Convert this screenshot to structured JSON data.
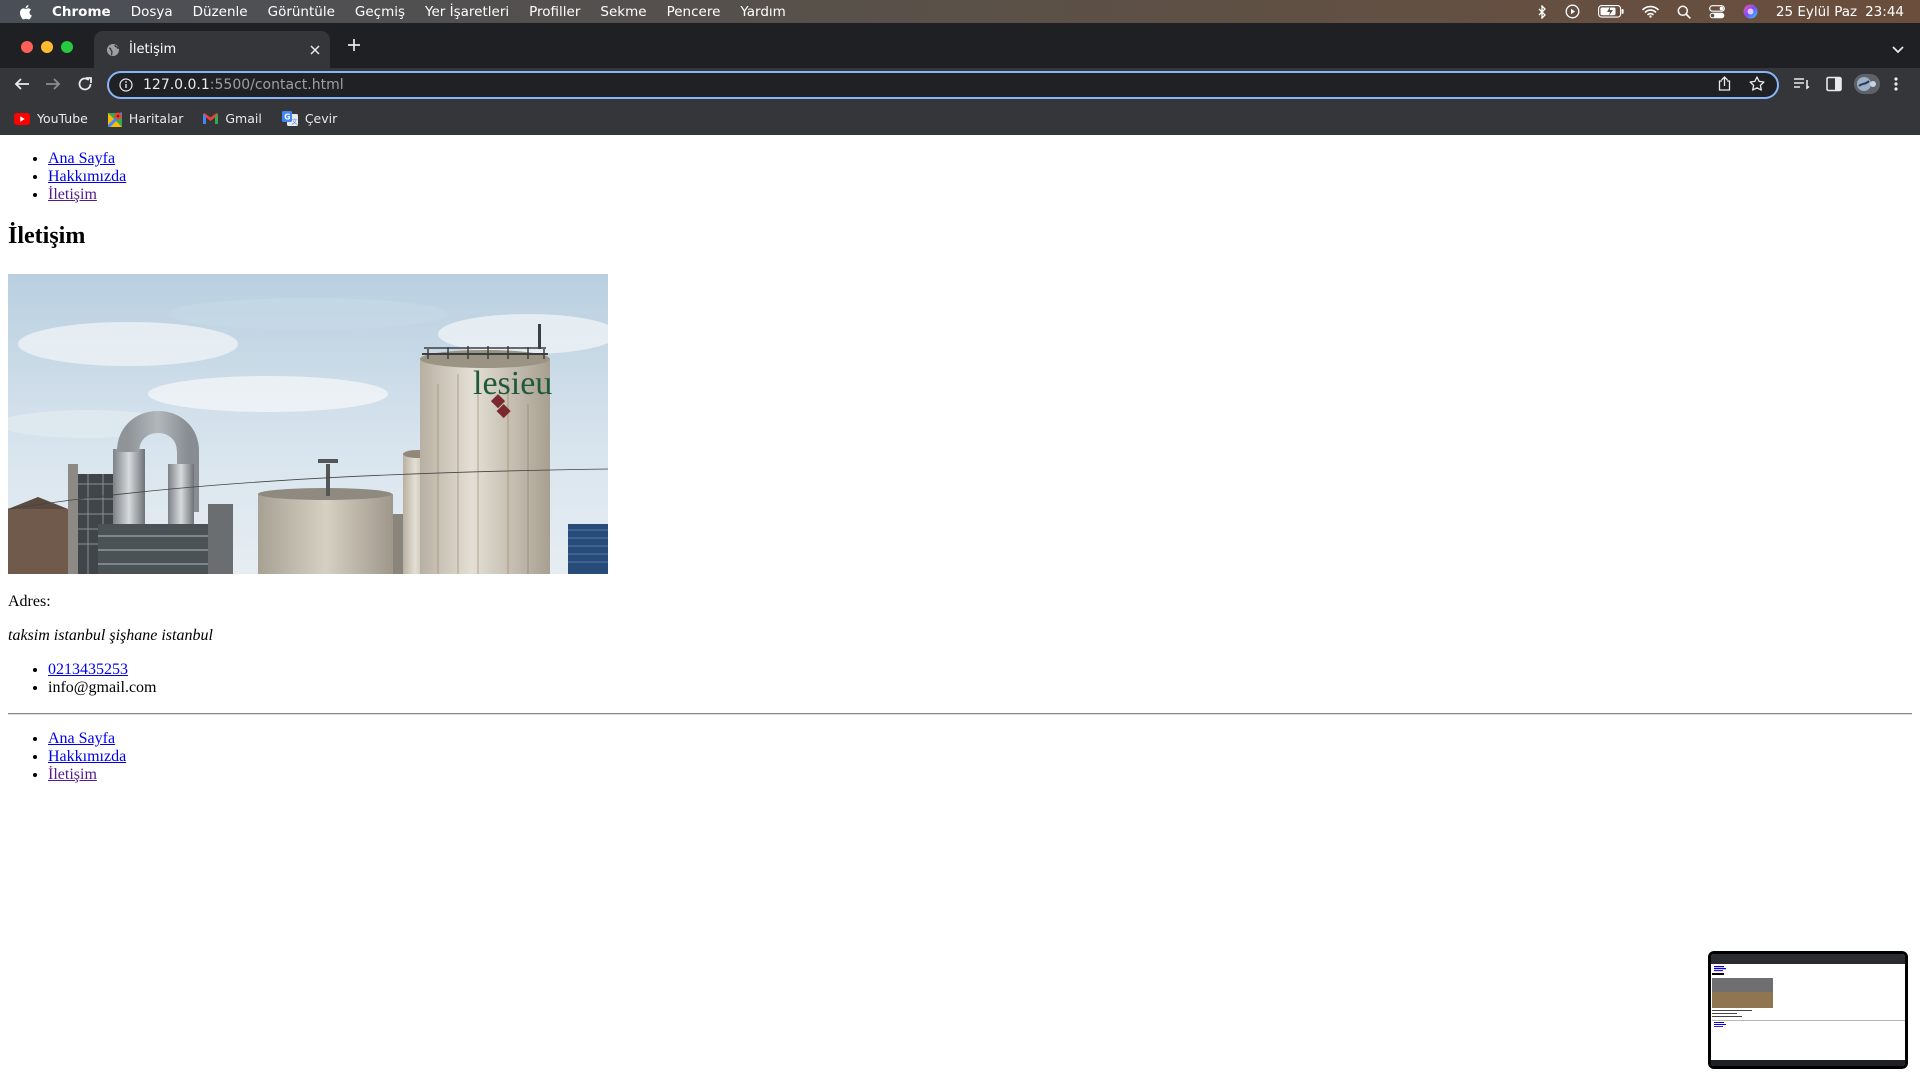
{
  "menubar": {
    "app": "Chrome",
    "items": [
      "Dosya",
      "Düzenle",
      "Görüntüle",
      "Geçmiş",
      "Yer İşaretleri",
      "Profiller",
      "Sekme",
      "Pencere",
      "Yardım"
    ],
    "date": "25 Eylül Paz",
    "time": "23:44"
  },
  "browser": {
    "tab_title": "İletişim",
    "url_host": "127.0.0.1",
    "url_rest": ":5500/contact.html",
    "bookmarks": [
      {
        "label": "YouTube",
        "icon": "youtube-icon"
      },
      {
        "label": "Haritalar",
        "icon": "maps-icon"
      },
      {
        "label": "Gmail",
        "icon": "gmail-icon"
      },
      {
        "label": "Çevir",
        "icon": "translate-icon"
      }
    ]
  },
  "page": {
    "nav": [
      "Ana Sayfa",
      "Hakkımızda",
      "İletişim"
    ],
    "heading": "İletişim",
    "image_sign": "lesieu",
    "address_label": "Adres:",
    "address": "taksim istanbul şişhane istanbul",
    "phone": "0213435253",
    "email": "info@gmail.com",
    "footer_nav": [
      "Ana Sayfa",
      "Hakkımızda",
      "İletişim"
    ]
  },
  "colors": {
    "link": "#0000ee",
    "visited_link": "#551a8b",
    "omnibox_focus": "#8ab4f8"
  }
}
